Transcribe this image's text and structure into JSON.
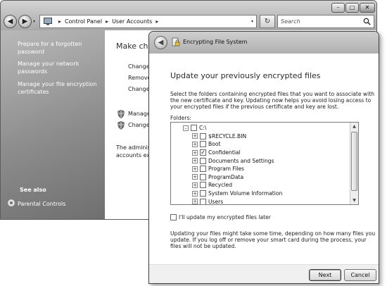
{
  "background_window": {
    "title_buttons": {
      "minimize": "–",
      "maximize": "□",
      "close": "✕"
    },
    "nav": {
      "back": "◀",
      "forward": "▶",
      "dropdown": "▾"
    },
    "address_bar": {
      "crumbs": [
        "Control Panel",
        "User Accounts"
      ],
      "separator": "▸",
      "dropdown": "▾"
    },
    "refresh": "↻",
    "search": {
      "placeholder": "Search"
    },
    "tasks": [
      "Prepare for a forgotten password",
      "Manage your network passwords",
      "Manage your file encryption certificates"
    ],
    "see_also": "See also",
    "parental_controls": "Parental Controls",
    "content": {
      "title": "Make cha",
      "links": [
        "Change",
        "Remove",
        "Change"
      ],
      "shield_links": [
        "Manage",
        "Change"
      ],
      "admin_line1": "The adminis",
      "admin_line2": "accounts ex"
    }
  },
  "dialog": {
    "back": "◀",
    "title": "Encrypting File System",
    "heading": "Update your previously encrypted files",
    "paragraph": "Select the folders containing encrypted files that you want to associate with the new certificate and key. Updating now helps you avoid losing access to your encrypted files if the previous certificate and key are lost.",
    "folders_label": "Folders:",
    "tree": [
      {
        "label": "C:\\",
        "level": 0,
        "expander": "–",
        "checked": false
      },
      {
        "label": "$RECYCLE.BIN",
        "level": 1,
        "expander": "+",
        "checked": false
      },
      {
        "label": "Boot",
        "level": 1,
        "expander": "+",
        "checked": false
      },
      {
        "label": "Confidential",
        "level": 1,
        "expander": "+",
        "checked": true
      },
      {
        "label": "Documents and Settings",
        "level": 1,
        "expander": "+",
        "checked": false
      },
      {
        "label": "Program Files",
        "level": 1,
        "expander": "+",
        "checked": false
      },
      {
        "label": "ProgramData",
        "level": 1,
        "expander": "+",
        "checked": false
      },
      {
        "label": "Recycled",
        "level": 1,
        "expander": "+",
        "checked": false
      },
      {
        "label": "System Volume Information",
        "level": 1,
        "expander": "+",
        "checked": false
      },
      {
        "label": "Users",
        "level": 1,
        "expander": "+",
        "checked": false
      }
    ],
    "check_mark": "✓",
    "scroll_up": "▲",
    "scroll_down": "▼",
    "later_label": "I'll update my encrypted files later",
    "note": "Updating your files might take some time, depending on how many files you update. If you log off or remove your smart card during the process, your files will not be updated.",
    "next_label": "Next",
    "cancel_label": "Cancel"
  }
}
